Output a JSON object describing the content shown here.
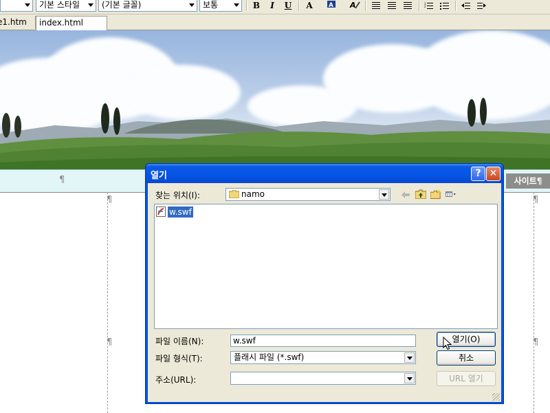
{
  "toolbar": {
    "style_combo": "기본 스타일",
    "font_combo": "(기본 글꼴)",
    "size_combo": "보통",
    "bold": "B",
    "italic": "I",
    "underline": "U",
    "font_color": "A"
  },
  "tabs": [
    {
      "label": "e1.htm",
      "active": false
    },
    {
      "label": "index.html",
      "active": true
    }
  ],
  "page": {
    "site_button": "사이트¶",
    "pilcrow": "¶"
  },
  "dialog": {
    "title": "열기",
    "help": "?",
    "close": "✕",
    "look_in_label": "찾는 위치(I):",
    "look_in_value": "namo",
    "files": [
      {
        "name": "w.swf",
        "selected": true,
        "icon": "flash-file-icon"
      }
    ],
    "file_name_label": "파일 이름(N):",
    "file_name_value": "w.swf",
    "file_type_label": "파일 형식(T):",
    "file_type_value": "플래시 파일 (*.swf)",
    "address_label": "주소(URL):",
    "address_value": "",
    "open_button": "열기(O)",
    "cancel_button": "취소",
    "url_open_button": "URL 열기"
  },
  "colors": {
    "title_bar": "#0554e3",
    "dialog_face": "#ece9d8",
    "selection": "#316ac5",
    "nav_strip": "#e2f6f7"
  }
}
